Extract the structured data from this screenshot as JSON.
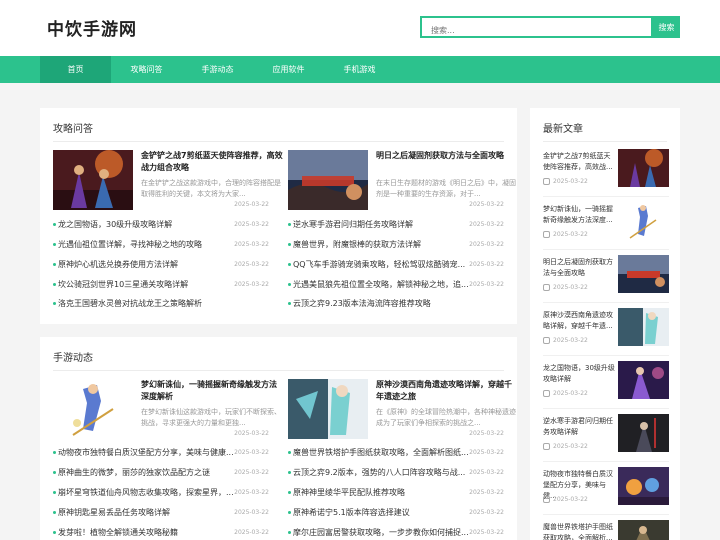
{
  "site": {
    "logo": "中饮手游网"
  },
  "search": {
    "placeholder": "搜索...",
    "button_label": "搜索"
  },
  "nav": {
    "items": [
      {
        "label": "首页"
      },
      {
        "label": "攻略问答"
      },
      {
        "label": "手游动态"
      },
      {
        "label": "应用软件"
      },
      {
        "label": "手机游戏"
      }
    ]
  },
  "guides": {
    "title": "攻略问答",
    "features": [
      {
        "title": "金铲铲之战7剪纸蓝天使阵容推荐，高效战力组合攻略",
        "desc": "在金铲铲之战这款游戏中，合理的阵容搭配是取得胜利的关键，本文将为大家...",
        "date": "2025-03-22"
      },
      {
        "title": "明日之后凝固剂获取方法与全面攻略",
        "desc": "在末日生存题材的游戏《明日之后》中，凝固剂是一种重要的生存资源，对于...",
        "date": "2025-03-22"
      }
    ],
    "left_list": [
      {
        "text": "龙之国物语，30级升级攻略详解",
        "date": "2025-03-22"
      },
      {
        "text": "光遇仙祖位置详解，寻找神秘之地的攻略",
        "date": "2025-03-22"
      },
      {
        "text": "原神炉心机选兑换券使用方法详解",
        "date": "2025-03-22"
      },
      {
        "text": "坎公骑冠剑世界10三星通关攻略详解",
        "date": "2025-03-22"
      },
      {
        "text": "洛克王国碧水灵兽对抗战龙王之策略解析",
        "date": "2025-03-22"
      }
    ],
    "right_list": [
      {
        "text": "逆水寒手游君问归期任务攻略详解",
        "date": "2025-03-22"
      },
      {
        "text": "魔兽世界，附魔银棒的获取方法详解",
        "date": "2025-03-22"
      },
      {
        "text": "QQ飞车手游骑宠骑乘攻略，轻松驾驭炫酷骑宠...",
        "date": "2025-03-22"
      },
      {
        "text": "光遇美鼠狼先祖位置全攻略，解锁神秘之地，追...",
        "date": "2025-03-22"
      },
      {
        "text": "云顶之弈9.23版本法海流阵容推荐攻略",
        "date": "2025-03-22"
      }
    ]
  },
  "news": {
    "title": "手游动态",
    "features": [
      {
        "title": "梦幻新诛仙，一骑摇握新奇缘触发方法深度解析",
        "desc": "在梦幻新诛仙这款游戏中，玩家们不断探索、挑战，寻求更强大的力量和更独...",
        "date": "2025-03-22"
      },
      {
        "title": "原神沙漠西南角遗迹攻略详解，穿越千年遗迹之旅",
        "desc": "在《原神》的全球冒险热潮中，各种神秘遗迹成为了玩家们争相探索的挑战之...",
        "date": "2025-03-22"
      }
    ],
    "left_list": [
      {
        "text": "动物夜市独特餐白质汉堡配方分享，美味与健康...",
        "date": "2025-03-22"
      },
      {
        "text": "原神曲生的微梦，丽莎的独家饮品配方之谜",
        "date": "2025-03-22"
      },
      {
        "text": "崩坏星穹铁道仙舟风物志收集攻略，探索星界，...",
        "date": "2025-03-22"
      },
      {
        "text": "原神钥匙星易丢品任务攻略详解",
        "date": "2025-03-22"
      },
      {
        "text": "发芽啦！植物全解锁通关攻略秘籍",
        "date": "2025-03-22"
      }
    ],
    "right_list": [
      {
        "text": "魔兽世界铁塔护手图纸获取攻略，全面解析图纸...",
        "date": "2025-03-22"
      },
      {
        "text": "云顶之弈9.2版本，强势的八人口阵容攻略与战...",
        "date": "2025-03-22"
      },
      {
        "text": "原神神里绫华平民配队推荐攻略",
        "date": "2025-03-22"
      },
      {
        "text": "原神希诺宁5.1版本阵容选择建议",
        "date": "2025-03-22"
      },
      {
        "text": "摩尔庄园富居警获取攻略，一步步教你如何捕捉...",
        "date": "2025-03-22"
      }
    ]
  },
  "latest": {
    "title": "最新文章",
    "items": [
      {
        "title": "金铲铲之战7剪纸蓝天使阵容推荐，高效战...",
        "date": "2025-03-22"
      },
      {
        "title": "梦幻新诛仙，一骑摇握新奇缘触发方法深度...",
        "date": "2025-03-22"
      },
      {
        "title": "明日之后凝固剂获取方法与全面攻略",
        "date": "2025-03-22"
      },
      {
        "title": "原神沙漠西南角遗迹攻略详解，穿越千年遗...",
        "date": "2025-03-22"
      },
      {
        "title": "龙之国物语，30级升级攻略详解",
        "date": "2025-03-22"
      },
      {
        "title": "逆水寒手游君问归期任务攻略详解",
        "date": "2025-03-22"
      },
      {
        "title": "动物夜市独特餐白质汉堡配方分享，美味与健...",
        "date": "2025-03-22"
      },
      {
        "title": "魔兽世界铁塔护手图纸获取攻略，全面解析...",
        "date": ""
      }
    ]
  },
  "colors": {
    "accent": "#2cc28d",
    "accent_dark": "#1ea678"
  }
}
